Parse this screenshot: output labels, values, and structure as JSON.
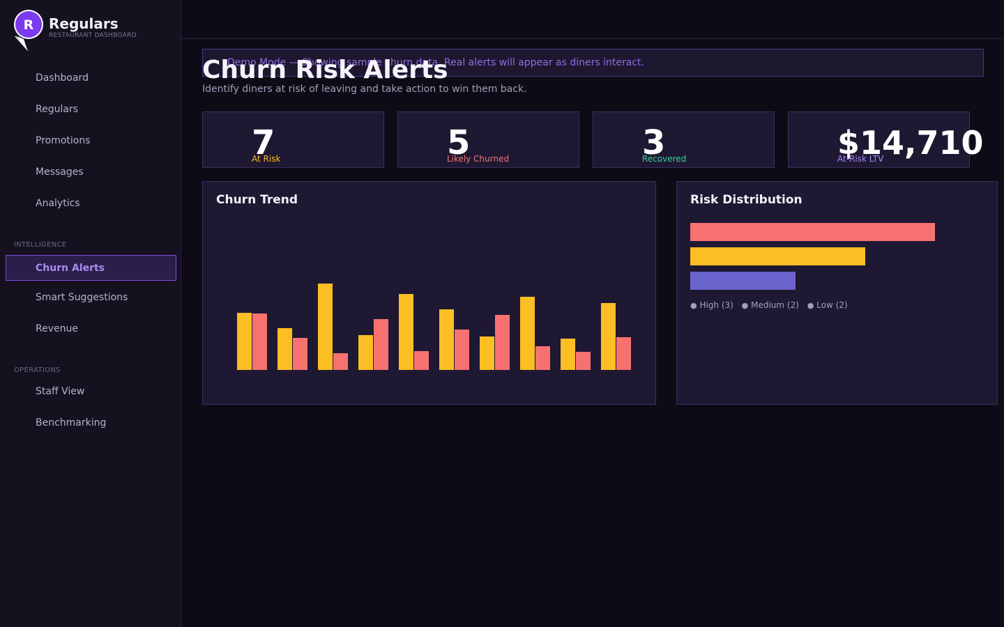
{
  "brand": {
    "logo_letter": "R",
    "name": "Regulars",
    "subtitle": "RESTAURANT DASHBOARD"
  },
  "sidebar": {
    "items": [
      {
        "label": "Dashboard"
      },
      {
        "label": "Regulars"
      },
      {
        "label": "Promotions"
      },
      {
        "label": "Messages"
      },
      {
        "label": "Analytics"
      }
    ],
    "sections": [
      {
        "title": "INTELLIGENCE",
        "items": [
          {
            "label": "Churn Alerts",
            "active": true
          },
          {
            "label": "Smart Suggestions"
          },
          {
            "label": "Revenue"
          }
        ]
      },
      {
        "title": "OPERATIONS",
        "items": [
          {
            "label": "Staff View"
          },
          {
            "label": "Benchmarking"
          }
        ]
      }
    ]
  },
  "banner": {
    "text": "Demo Mode — Showing sample churn data. Real alerts will appear as diners interact."
  },
  "page": {
    "title": "Churn Risk Alerts",
    "subtitle": "Identify diners at risk of leaving and take action to win them back."
  },
  "stats": [
    {
      "value": "7",
      "label": "At Risk",
      "color": "#fbbf24"
    },
    {
      "value": "5",
      "label": "Likely Churned",
      "color": "#f87171"
    },
    {
      "value": "3",
      "label": "Recovered",
      "color": "#34d399"
    },
    {
      "value": "$14,710",
      "label": "At-Risk LTV",
      "color": "#a78bfa"
    }
  ],
  "trend": {
    "title": "Churn Trend"
  },
  "distribution": {
    "title": "Risk Distribution",
    "legend": [
      {
        "label": "High (3)"
      },
      {
        "label": "Medium (2)"
      },
      {
        "label": "Low (2)"
      }
    ]
  },
  "chart_data": [
    {
      "type": "bar",
      "title": "Churn Trend",
      "series": [
        {
          "values": [
            82,
            60,
            124,
            50,
            109,
            87,
            48,
            105,
            45,
            96
          ]
        },
        {
          "values": [
            81,
            46,
            24,
            73,
            27,
            58,
            79,
            34,
            26,
            47
          ]
        }
      ],
      "colors": [
        "#fbbf24",
        "#f87171"
      ],
      "ylim": [
        0,
        220
      ],
      "grid": false
    },
    {
      "type": "bar",
      "orientation": "horizontal",
      "title": "Risk Distribution",
      "categories": [
        "High",
        "Medium",
        "Low"
      ],
      "values": [
        3,
        2,
        2
      ],
      "colors": [
        "#f87171",
        "#fbbf24",
        "#6b63cc"
      ]
    }
  ],
  "distribution_bar_levels": [
    1.0,
    0.715,
    0.43
  ]
}
